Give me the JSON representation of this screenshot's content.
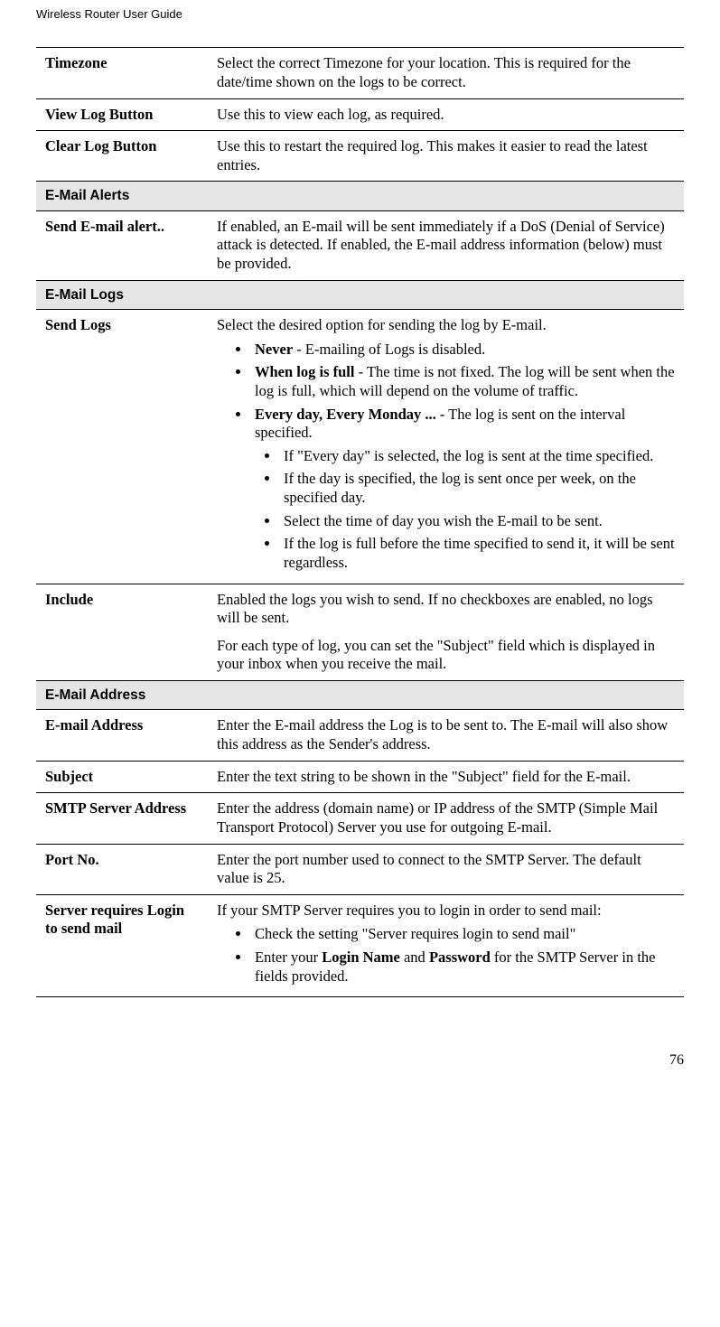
{
  "header": {
    "title": "Wireless Router User Guide"
  },
  "rows": {
    "timezone": {
      "label": "Timezone",
      "desc": "Select the correct Timezone for your location. This is required for the date/time shown on the logs to be correct."
    },
    "viewLog": {
      "label": "View Log Button",
      "desc": "Use this to view each log, as required."
    },
    "clearLog": {
      "label": "Clear Log Button",
      "desc": "Use this to restart the required log. This makes it easier to read the latest entries."
    },
    "emailAlertsSection": "E-Mail Alerts",
    "sendAlert": {
      "label": "Send E-mail alert..",
      "desc": "If enabled, an E-mail will be sent immediately if a DoS (Denial of Service) attack is detected. If enabled, the E-mail address information (below) must be provided."
    },
    "emailLogsSection": "E-Mail Logs",
    "sendLogs": {
      "label": "Send Logs",
      "intro": "Select the desired option for sending the log by E-mail.",
      "b1": {
        "b": "Never",
        "t": " - E-mailing of Logs is disabled."
      },
      "b2": {
        "b": "When log is full",
        "t": " - The time is not fixed. The log will be sent when the log is full, which will depend on the volume of traffic."
      },
      "b3": {
        "b": "Every day, Every Monday ...",
        "t": "  - The log is sent on the interval specified."
      },
      "sub1": "If \"Every day\" is selected, the log is sent at the time specified.",
      "sub2": "If the day is specified, the log is sent once per week, on the specified day.",
      "sub3": "Select the time of day you wish the E-mail to be sent.",
      "sub4": "If the log is full before the time specified to send it, it will be sent regardless."
    },
    "include": {
      "label": "Include",
      "p1": "Enabled the logs you wish to send. If no checkboxes are enabled, no logs will be sent.",
      "p2": "For each type of log, you can set the \"Subject\" field which is displayed in your inbox when you receive the mail."
    },
    "emailAddressSection": "E-Mail Address",
    "emailAddr": {
      "label": "E-mail Address",
      "desc": "Enter the E-mail address the Log is to be sent to. The E-mail will also show this address as the Sender's address."
    },
    "subject": {
      "label": "Subject",
      "desc": "Enter the text string to be shown in the \"Subject\" field for the E-mail."
    },
    "smtp": {
      "label": "SMTP Server Address",
      "desc": "Enter the address (domain name) or IP address of the SMTP (Simple Mail Transport Protocol) Server you use for outgoing E-mail."
    },
    "portNo": {
      "label": "Port No.",
      "desc": "Enter the port number used to connect to the SMTP Server. The default value is 25."
    },
    "serverLogin": {
      "label": "Server requires Login to send mail",
      "intro": "If your SMTP Server requires you to login in order to send mail:",
      "b1": "Check the setting \"Server requires login to send mail\"",
      "b2_pre": "Enter your ",
      "b2_b1": "Login Name",
      "b2_mid": " and ",
      "b2_b2": "Password",
      "b2_post": " for the SMTP Server in the fields provided."
    }
  },
  "pageNumber": "76"
}
